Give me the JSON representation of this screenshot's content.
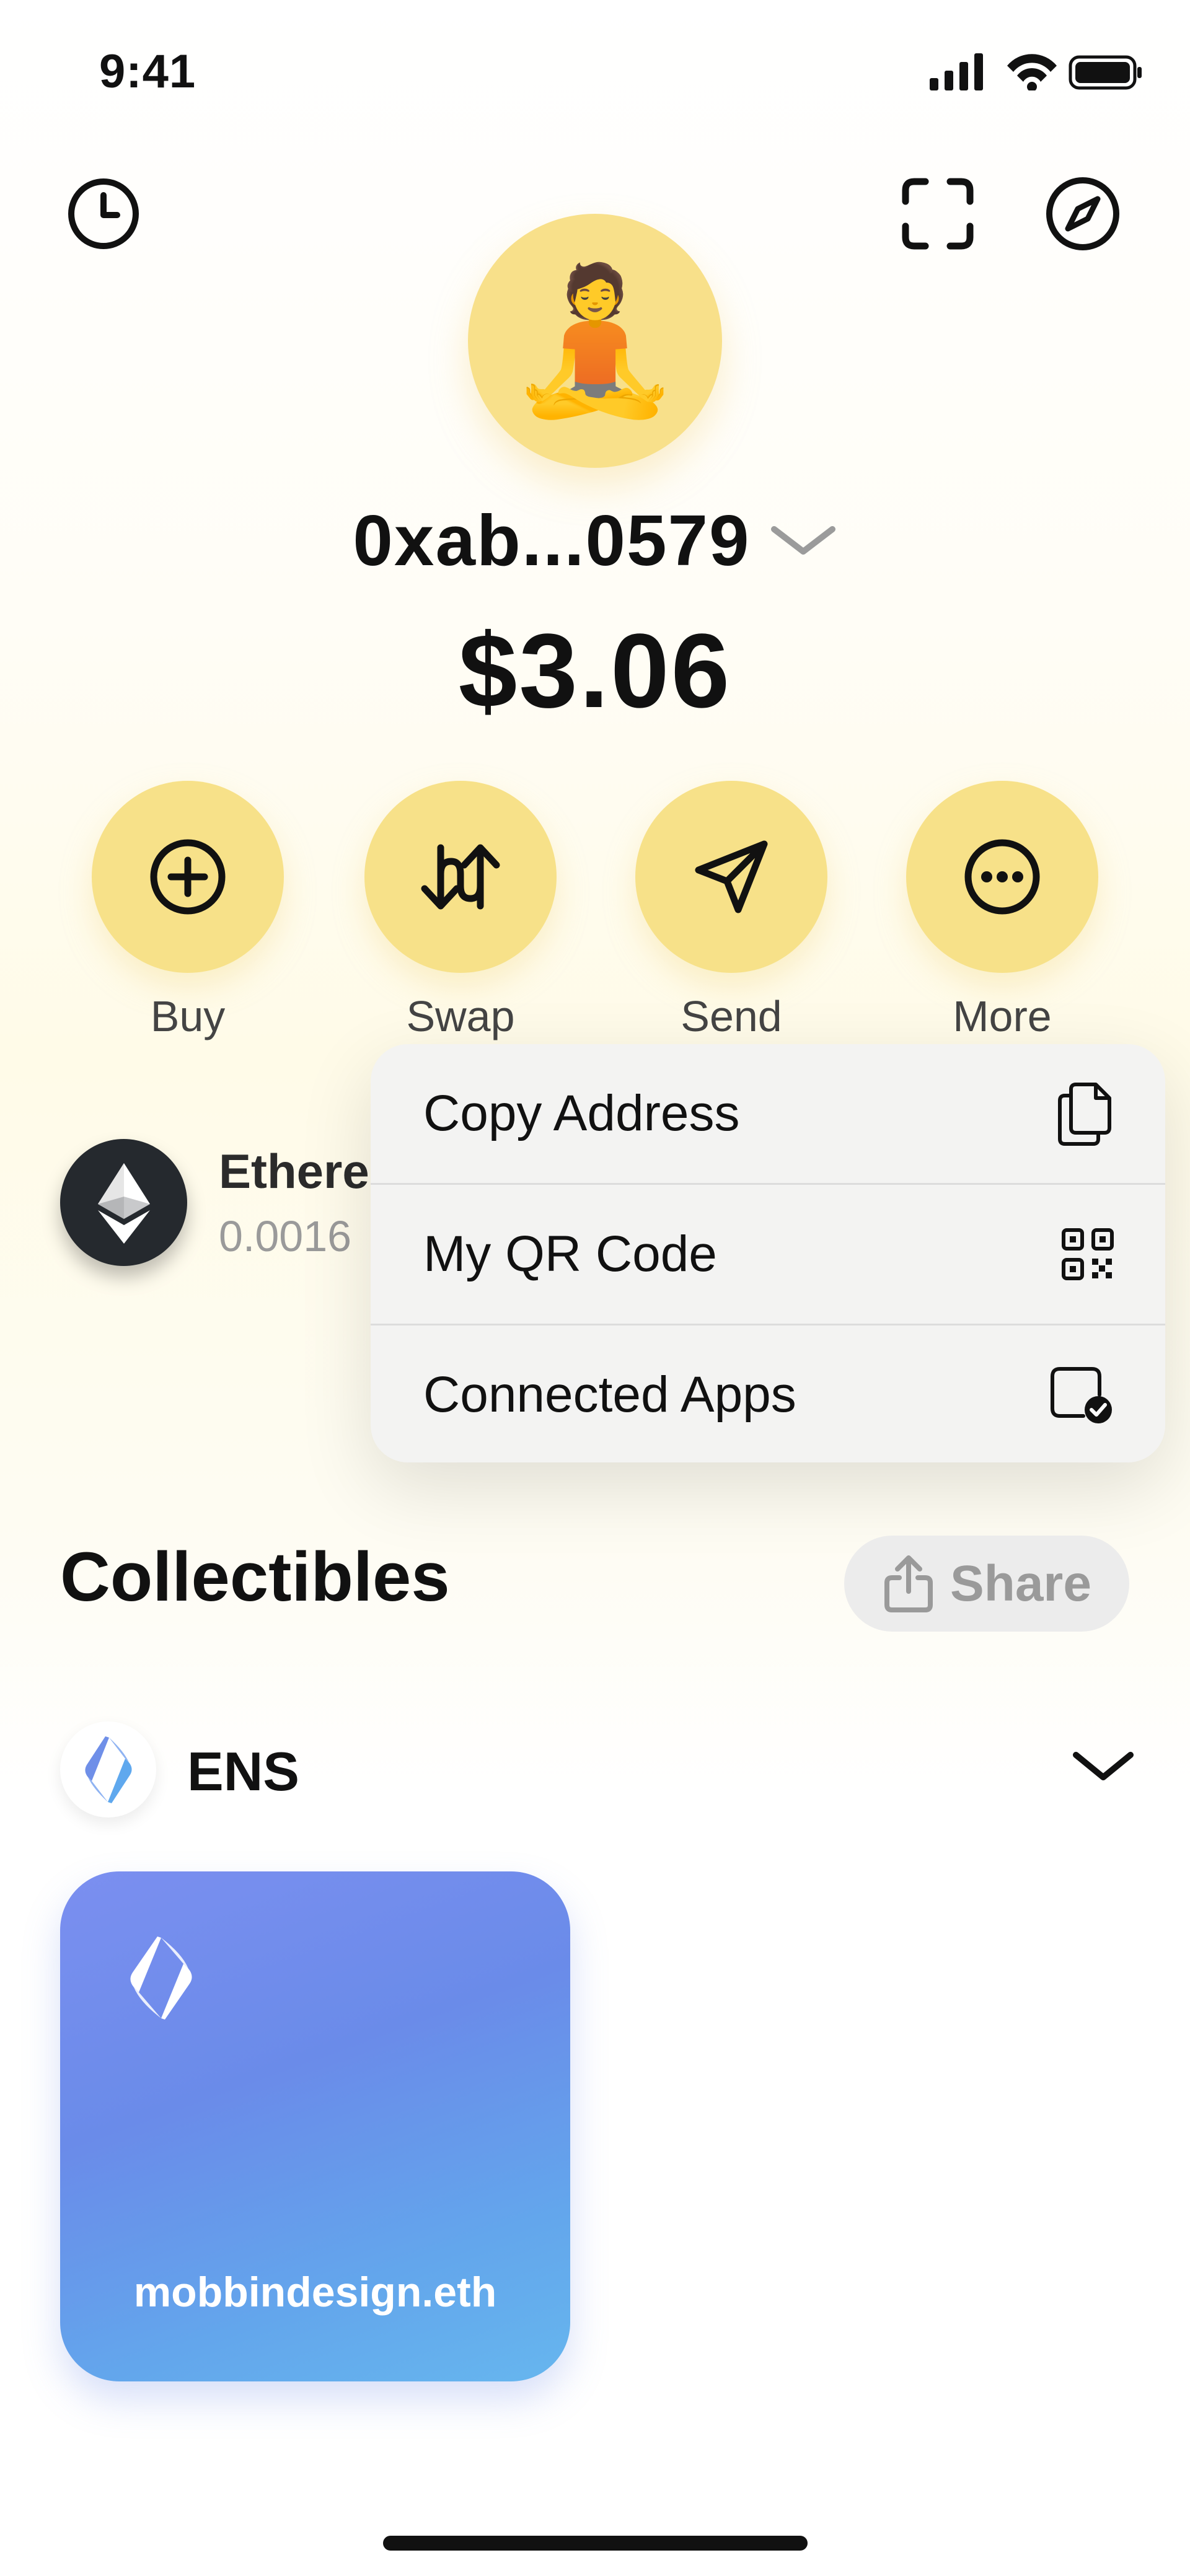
{
  "status_bar": {
    "time": "9:41",
    "icons": [
      "signal-icon",
      "wifi-icon",
      "battery-icon"
    ]
  },
  "header": {
    "left_icon": "history-clock-icon",
    "right_icons": [
      "scan-icon",
      "compass-icon"
    ]
  },
  "profile": {
    "avatar_emoji": "🧘",
    "address": "0xab...0579",
    "balance": "$3.06"
  },
  "actions": [
    {
      "label": "Buy",
      "icon": "plus-circle-icon"
    },
    {
      "label": "Swap",
      "icon": "swap-arrows-icon"
    },
    {
      "label": "Send",
      "icon": "send-paper-plane-icon"
    },
    {
      "label": "More",
      "icon": "more-dots-icon"
    }
  ],
  "token": {
    "name": "Ethere",
    "amount": "0.0016"
  },
  "menu": {
    "items": [
      {
        "label": "Copy Address",
        "icon": "copy-icon"
      },
      {
        "label": "My QR Code",
        "icon": "qr-code-icon"
      },
      {
        "label": "Connected Apps",
        "icon": "connected-apps-icon"
      }
    ]
  },
  "collectibles": {
    "title": "Collectibles",
    "share_label": "Share",
    "group_name": "ENS",
    "nft_title": "mobbindesign.eth"
  },
  "colors": {
    "accent_yellow": "#f7e189",
    "ens_gradient_start": "#7b8ff0",
    "ens_gradient_end": "#66b6ee"
  }
}
